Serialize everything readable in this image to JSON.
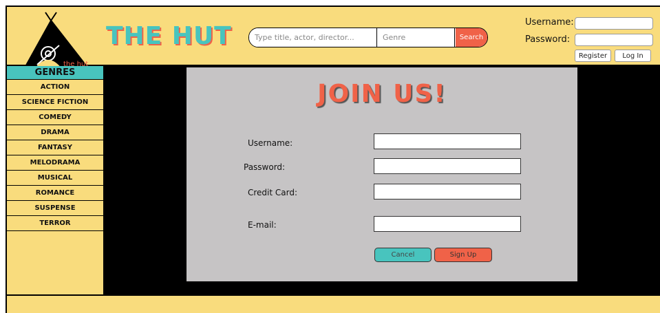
{
  "brand": {
    "logo_text": "the hut",
    "title": "THE HUT"
  },
  "search": {
    "title_placeholder": "Type title, actor, director...",
    "genre_placeholder": "Genre",
    "button_label": "Search"
  },
  "login": {
    "username_label": "Username:",
    "password_label": "Password:",
    "register_label": "Register",
    "login_label": "Log In"
  },
  "sidebar": {
    "heading": "GENRES",
    "items": [
      {
        "label": "ACTION"
      },
      {
        "label": "SCIENCE FICTION"
      },
      {
        "label": "COMEDY"
      },
      {
        "label": "DRAMA"
      },
      {
        "label": "FANTASY"
      },
      {
        "label": "MELODRAMA"
      },
      {
        "label": "MUSICAL"
      },
      {
        "label": "ROMANCE"
      },
      {
        "label": "SUSPENSE"
      },
      {
        "label": "TERROR"
      }
    ]
  },
  "form": {
    "title": "JOIN US!",
    "username_label": "Username:",
    "password_label": "Password:",
    "credit_card_label": "Credit Card:",
    "email_label": "E-mail:",
    "cancel_label": "Cancel",
    "signup_label": "Sign Up"
  },
  "colors": {
    "yellow": "#f9dc7d",
    "teal": "#48c4be",
    "coral": "#f06248",
    "panel_gray": "#c6c4c5"
  }
}
